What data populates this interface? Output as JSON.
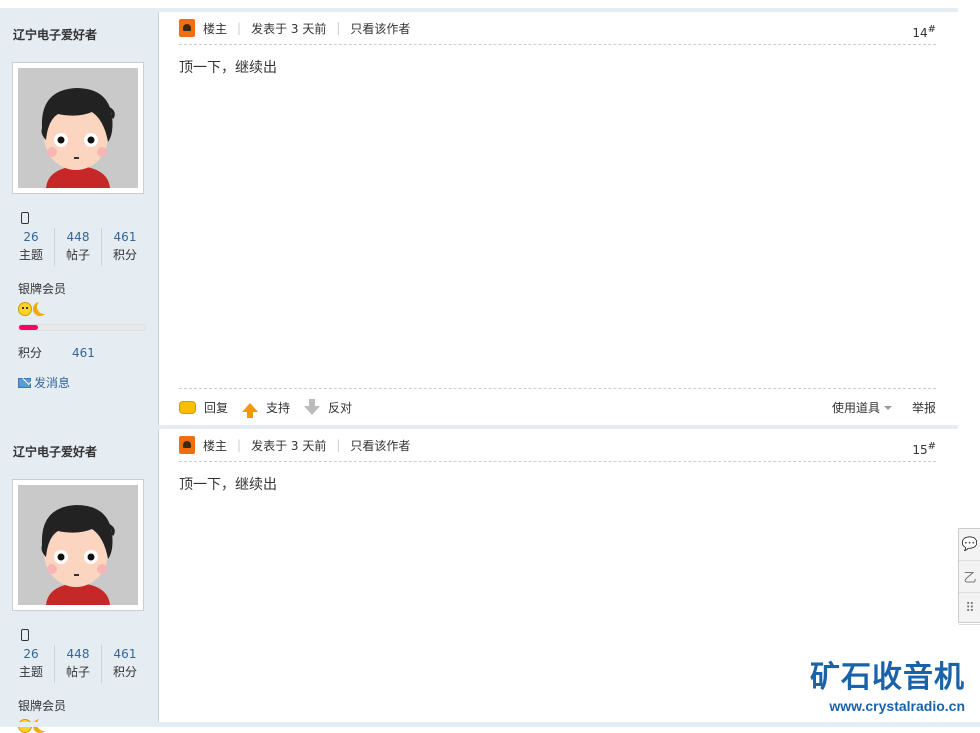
{
  "posts": [
    {
      "username": "辽宁电子爱好者",
      "stats": [
        {
          "value": "26",
          "label": "主题"
        },
        {
          "value": "448",
          "label": "帖子"
        },
        {
          "value": "461",
          "label": "积分"
        }
      ],
      "rank": "银牌会员",
      "progress_percent": 15,
      "score_label": "积分",
      "score_value": "461",
      "send_message": "发消息",
      "louzhu": "楼主",
      "posted": "发表于 3 天前",
      "only_author": "只看该作者",
      "floor": "14",
      "floor_mark": "#",
      "body": "顶一下，继续出",
      "reply": "回复",
      "support": "支持",
      "oppose": "反对",
      "use_tool": "使用道具",
      "report": "举报"
    },
    {
      "username": "辽宁电子爱好者",
      "stats": [
        {
          "value": "26",
          "label": "主题"
        },
        {
          "value": "448",
          "label": "帖子"
        },
        {
          "value": "461",
          "label": "积分"
        }
      ],
      "rank": "银牌会员",
      "louzhu": "楼主",
      "posted": "发表于 3 天前",
      "only_author": "只看该作者",
      "floor": "15",
      "floor_mark": "#",
      "body": "顶一下，继续出"
    }
  ],
  "side_tools": [
    "💬",
    "乙",
    "⠿"
  ],
  "watermark": {
    "name": "矿石收音机",
    "url": "www.crystalradio.cn"
  },
  "colors": {
    "link": "#336699",
    "sidebar": "#e5edf2",
    "brand": "#1a63a8"
  }
}
